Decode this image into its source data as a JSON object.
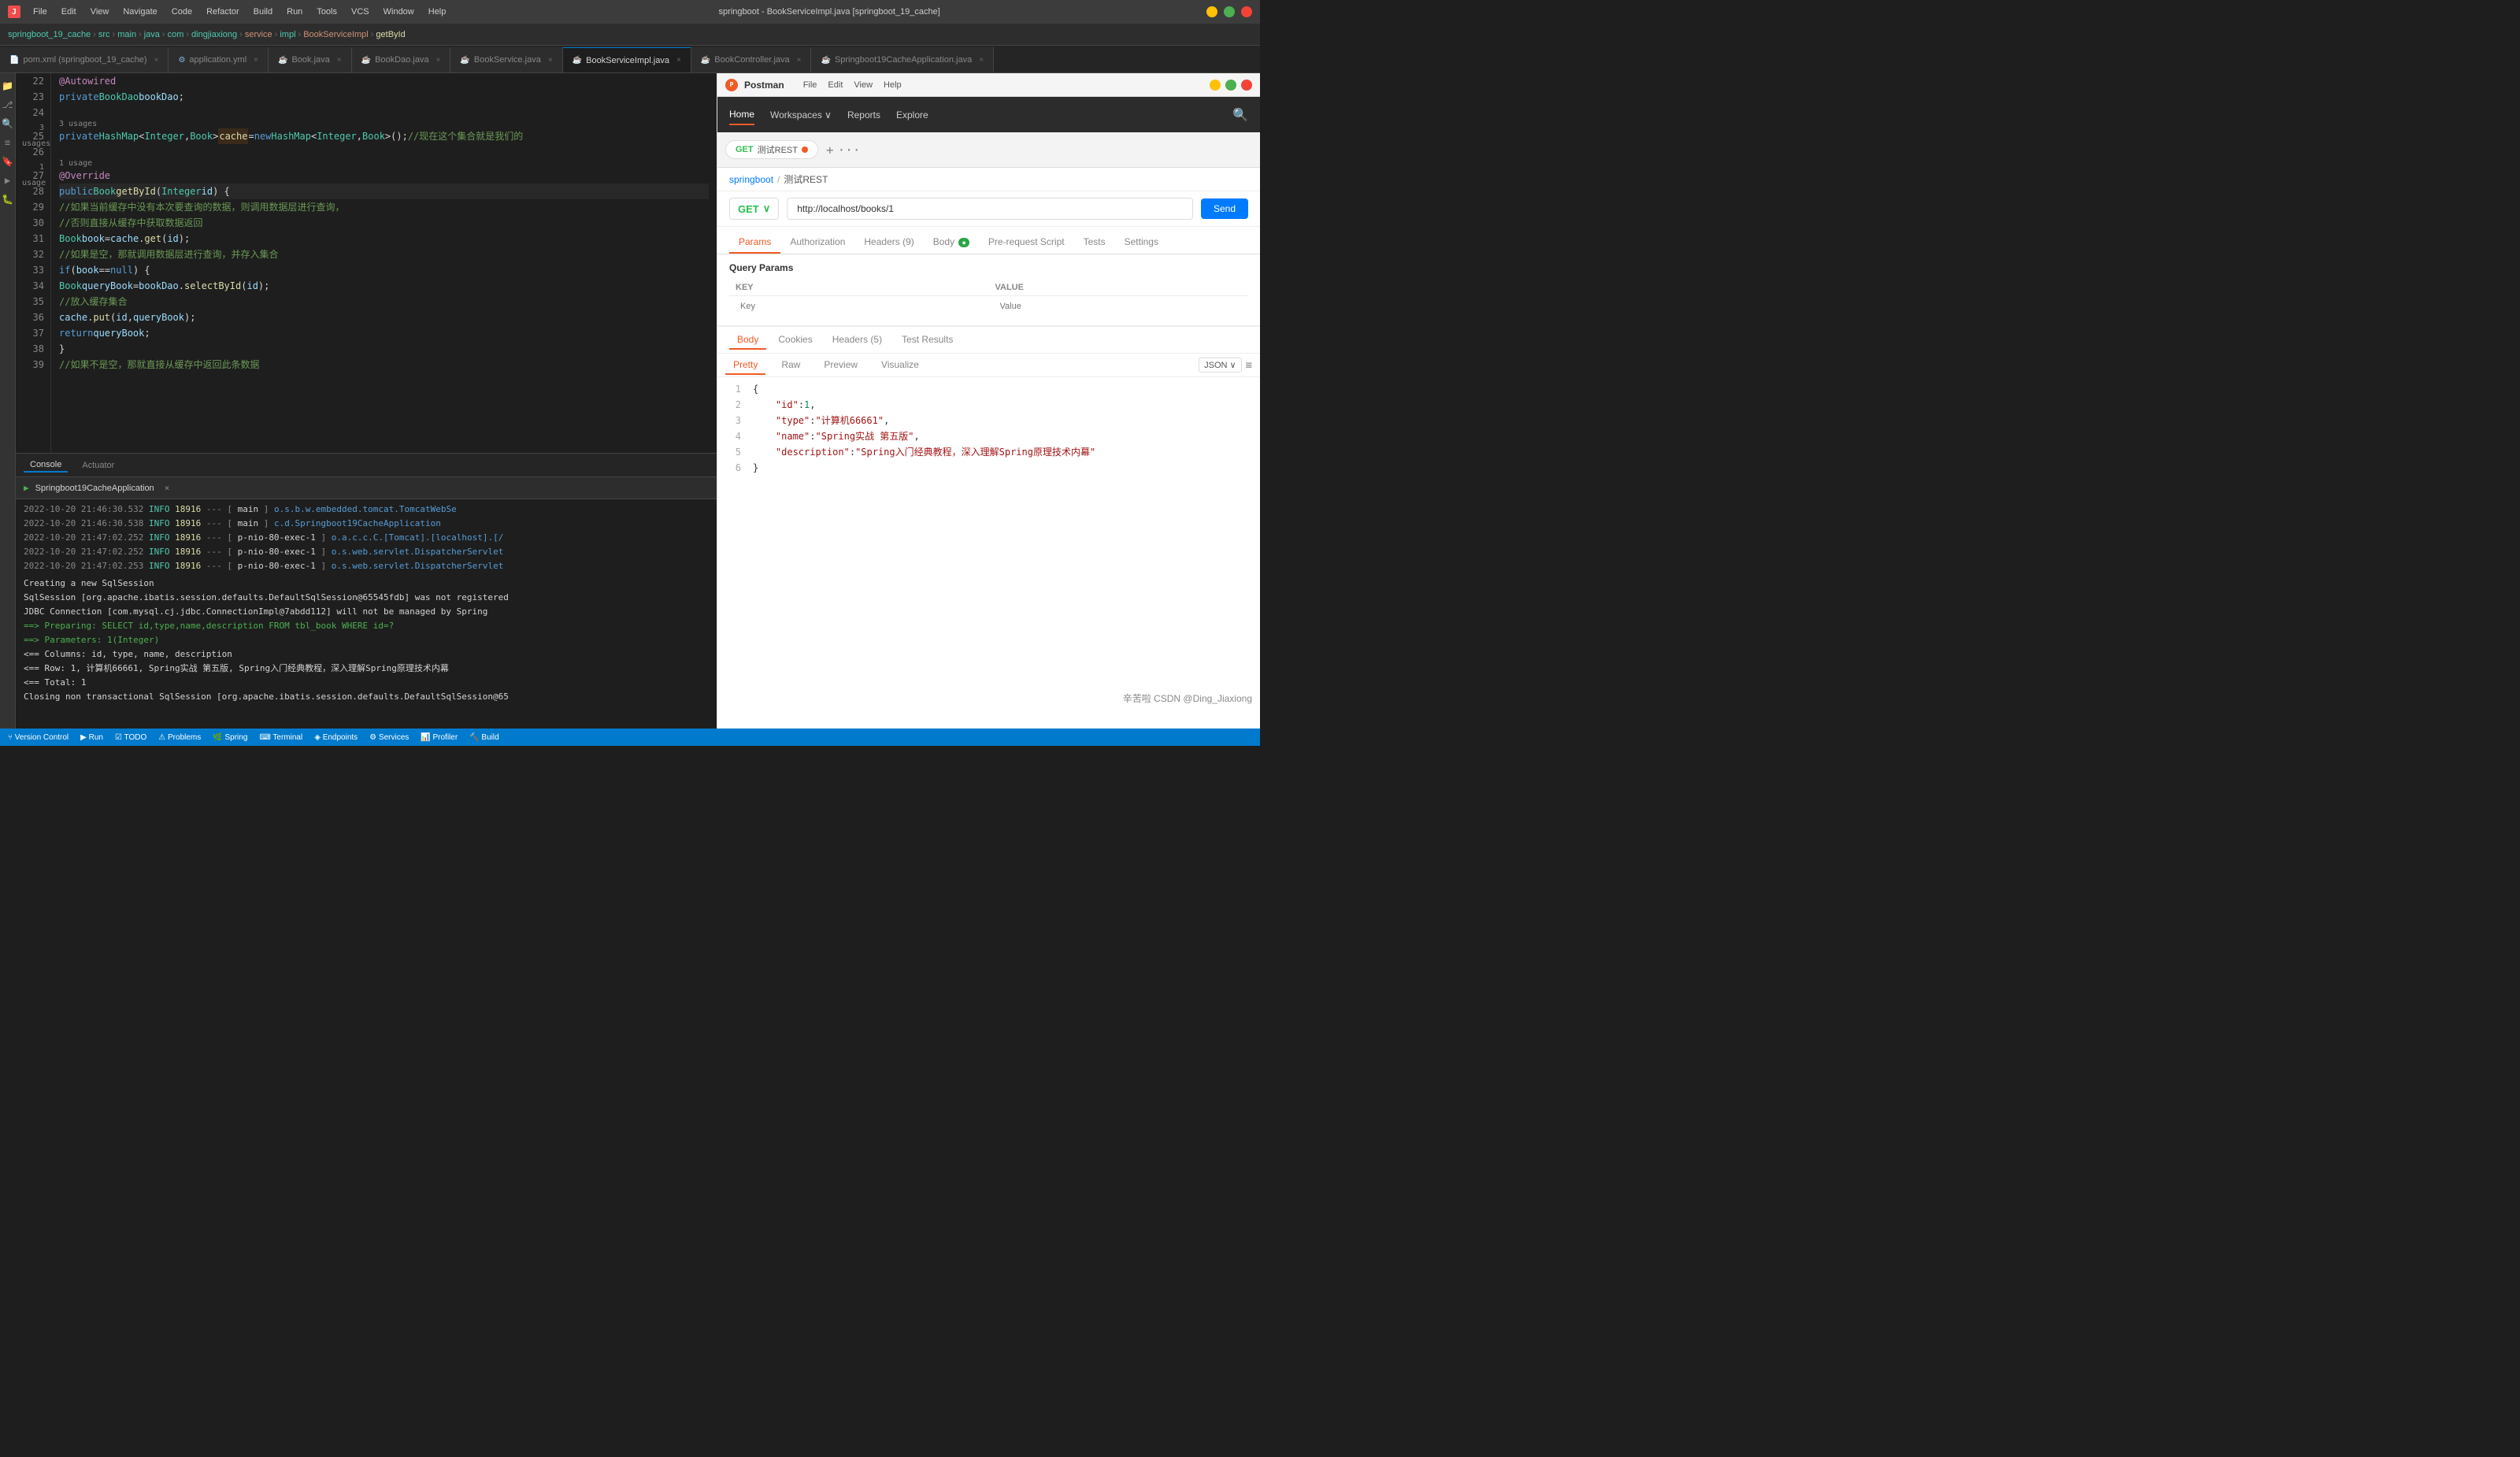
{
  "titleBar": {
    "title": "springboot - BookServiceImpl.java [springboot_19_cache]",
    "menus": [
      "File",
      "Edit",
      "View",
      "Navigate",
      "Code",
      "Refactor",
      "Build",
      "Run",
      "Tools",
      "VCS",
      "Window",
      "Help"
    ]
  },
  "breadcrumb": {
    "project": "springboot_19_cache",
    "path": [
      "src",
      "main",
      "java",
      "com",
      "dingjiaxiong",
      "service",
      "impl"
    ],
    "file": "BookServiceImpl",
    "method": "getById"
  },
  "tabs": [
    {
      "label": "pom.xml (springboot_19_cache)",
      "type": "xml",
      "active": false
    },
    {
      "label": "application.yml",
      "type": "yml",
      "active": false
    },
    {
      "label": "Book.java",
      "type": "java",
      "active": false
    },
    {
      "label": "BookDao.java",
      "type": "java_interface",
      "active": false
    },
    {
      "label": "BookService.java",
      "type": "java_interface",
      "active": false
    },
    {
      "label": "BookServiceImpl.java",
      "type": "java_impl",
      "active": true
    },
    {
      "label": "BookController.java",
      "type": "java",
      "active": false
    },
    {
      "label": "Springboot19CacheApplication.java",
      "type": "java",
      "active": false
    }
  ],
  "codeLines": [
    {
      "num": 22,
      "content": "    @Autowired",
      "type": "annotation"
    },
    {
      "num": 23,
      "content": "    private BookDao bookDao;",
      "type": "code"
    },
    {
      "num": 24,
      "content": "",
      "type": "empty"
    },
    {
      "num": 25,
      "content": "3 usages",
      "type": "usages"
    },
    {
      "num": 25,
      "content": "    private HashMap<Integer, Book> cache = new HashMap<Integer, Book>(); //现在这个集合就是我们的",
      "type": "code_cache"
    },
    {
      "num": 26,
      "content": "",
      "type": "empty"
    },
    {
      "num": 27,
      "content": "1 usage",
      "type": "usages"
    },
    {
      "num": 27,
      "content": "    @Override",
      "type": "annotation"
    },
    {
      "num": 28,
      "content": "    public Book getById(Integer id) {",
      "type": "code"
    },
    {
      "num": 29,
      "content": "        //如果当前缓存中没有本次要查询的数据，则调用数据层进行查询，",
      "type": "comment"
    },
    {
      "num": 30,
      "content": "        //否则直接从缓存中获取数据返回",
      "type": "comment"
    },
    {
      "num": 31,
      "content": "        Book book = cache.get(id);",
      "type": "code"
    },
    {
      "num": 32,
      "content": "        //如果是空，那就调用数据层进行查询，并存入集合",
      "type": "comment"
    },
    {
      "num": 33,
      "content": "        if (book == null) {",
      "type": "code"
    },
    {
      "num": 34,
      "content": "            Book queryBook = bookDao.selectById(id);",
      "type": "code"
    },
    {
      "num": 35,
      "content": "            //放入缓存集合",
      "type": "comment"
    },
    {
      "num": 36,
      "content": "            cache.put(id,queryBook);",
      "type": "code"
    },
    {
      "num": 37,
      "content": "            return queryBook;",
      "type": "code"
    },
    {
      "num": 38,
      "content": "        }",
      "type": "code"
    },
    {
      "num": 39,
      "content": "        //如果不是空，那就直接从缓存中返回此条数据",
      "type": "comment"
    }
  ],
  "console": {
    "tabs": [
      "Console",
      "Actuator"
    ],
    "runApp": "Springboot19CacheApplication",
    "logs": [
      {
        "date": "2022-10-20 21:46:30.532",
        "level": "INFO",
        "thread": "18916",
        "separator": "---",
        "context": "[",
        "ctx": "main",
        "ctxEnd": "]",
        "class": "o.s.b.w.embedded.tomcat.TomcatWebSe"
      },
      {
        "date": "2022-10-20 21:46:30.538",
        "level": "INFO",
        "thread": "18916",
        "separator": "---",
        "context": "[",
        "ctx": "main",
        "ctxEnd": "]",
        "class": "c.d.Springboot19CacheApplication"
      },
      {
        "date": "2022-10-20 21:47:02.252",
        "level": "INFO",
        "thread": "18916",
        "separator": "---",
        "context": "[",
        "ctx": "p-nio-80-exec-1",
        "ctxEnd": "]",
        "class": "o.a.c.c.C.[Tomcat].[localhost].[/"
      },
      {
        "date": "2022-10-20 21:47:02.252",
        "level": "INFO",
        "thread": "18916",
        "separator": "---",
        "context": "[",
        "ctx": "p-nio-80-exec-1",
        "ctxEnd": "]",
        "class": "o.s.web.servlet.DispatcherServlet"
      },
      {
        "date": "2022-10-20 21:47:02.253",
        "level": "INFO",
        "thread": "18916",
        "separator": "---",
        "context": "[",
        "ctx": "p-nio-80-exec-1",
        "ctxEnd": "]",
        "class": "o.s.web.servlet.DispatcherServlet"
      }
    ],
    "sqlLogs": [
      "Creating a new SqlSession",
      "SqlSession [org.apache.ibatis.session.defaults.DefaultSqlSession@65545fdb] was not registered",
      "JDBC Connection [com.mysql.cj.jdbc.ConnectionImpl@7abdd112] will not be managed by Spring",
      "==>  Preparing: SELECT id,type,name,description FROM tbl_book WHERE id=?",
      "==> Parameters: 1(Integer)",
      "<==    Columns: id, type, name, description",
      "<==        Row: 1, 计算机66661, Spring实战 第五版, Spring入门经典教程，深入理解Spring原理技术内幕",
      "<==      Total: 1",
      "Closing non transactional SqlSession [org.apache.ibatis.session.defaults.DefaultSqlSession@65"
    ]
  },
  "postman": {
    "title": "Postman",
    "nav": {
      "items": [
        "Home",
        "Workspaces",
        "Reports",
        "Explore"
      ],
      "activeItem": "Home"
    },
    "requestTab": {
      "method": "GET",
      "label": "测试REST",
      "dot": true
    },
    "breadcrumb": {
      "workspace": "springboot",
      "collection": "测试REST"
    },
    "request": {
      "method": "GET",
      "url": "http://localhost/books/1",
      "sendLabel": "Send"
    },
    "tabs": [
      {
        "label": "Params",
        "active": true
      },
      {
        "label": "Authorization",
        "active": false
      },
      {
        "label": "Headers (9)",
        "active": false
      },
      {
        "label": "Body",
        "active": false,
        "hasDot": true
      },
      {
        "label": "Pre-request Script",
        "active": false
      },
      {
        "label": "Tests",
        "active": false
      },
      {
        "label": "Settings",
        "active": false
      }
    ],
    "queryParams": {
      "title": "Query Params",
      "columns": [
        "KEY",
        "VALUE"
      ],
      "keyPlaceholder": "Key",
      "valuePlaceholder": "Value"
    },
    "bodyTabs": [
      {
        "label": "Body",
        "active": true
      },
      {
        "label": "Cookies",
        "active": false
      },
      {
        "label": "Headers (5)",
        "active": false
      },
      {
        "label": "Test Results",
        "active": false
      }
    ],
    "bodyViewTabs": [
      {
        "label": "Pretty",
        "active": true
      },
      {
        "label": "Raw",
        "active": false
      },
      {
        "label": "Preview",
        "active": false
      },
      {
        "label": "Visualize",
        "active": false
      }
    ],
    "jsonFormat": "JSON",
    "jsonResponse": [
      {
        "lineNum": "1",
        "content": "{"
      },
      {
        "lineNum": "2",
        "content": "    \"id\": 1,"
      },
      {
        "lineNum": "3",
        "content": "    \"type\": \"计算机66661\","
      },
      {
        "lineNum": "4",
        "content": "    \"name\": \"Spring实战 第五版\","
      },
      {
        "lineNum": "5",
        "content": "    \"description\": \"Spring入门经典教程，深入理解Spring原理技术内幕\""
      },
      {
        "lineNum": "6",
        "content": "}"
      }
    ]
  },
  "statusBar": {
    "branch": "Version Control",
    "run": "Run",
    "todo": "TODO",
    "problems": "Problems",
    "spring": "Spring",
    "terminal": "Terminal",
    "endpoints": "Endpoints",
    "services": "Services",
    "profiler": "Profiler",
    "build": "Build"
  }
}
